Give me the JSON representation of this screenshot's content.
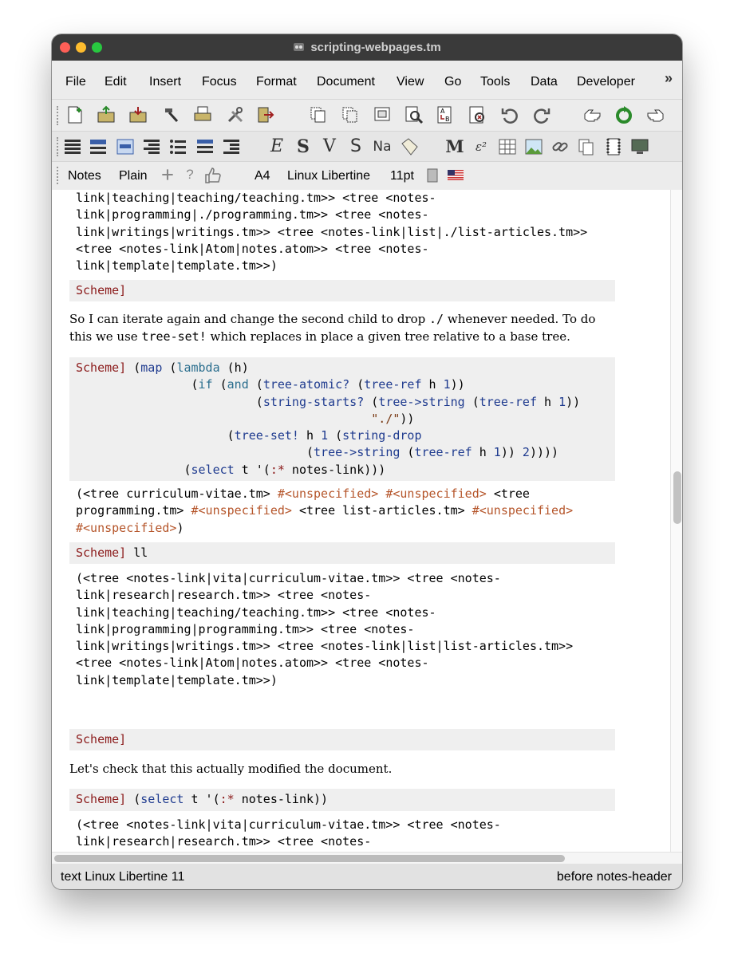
{
  "window": {
    "title": "scripting-webpages.tm"
  },
  "menu": {
    "items": [
      "File",
      "Edit",
      "Insert",
      "Focus",
      "Format",
      "Document",
      "View",
      "Go",
      "Tools",
      "Data",
      "Developer"
    ],
    "more": "»"
  },
  "format_bar": {
    "style": "Notes",
    "paragraph": "Plain",
    "paper": "A4",
    "font": "Linux Libertine",
    "size": "11pt"
  },
  "document": {
    "top_output": "link|teaching|teaching/teaching.tm>> <tree <notes-\nlink|programming|./programming.tm>> <tree <notes-\nlink|writings|writings.tm>> <tree <notes-link|list|./list-articles.tm>>\n<tree <notes-link|Atom|notes.atom>> <tree <notes-\nlink|template|template.tm>>)",
    "prompt": "Scheme]",
    "para1_a": "So I can iterate again and change the second child to drop ",
    "para1_code1": "./",
    "para1_b": " whenever needed. To do this we use ",
    "para1_code2": "tree-set!",
    "para1_c": " which replaces in place a given tree relative to a base tree.",
    "code": {
      "l1_map": "map",
      "l1_lambda": "lambda",
      "l1_h": " (h)",
      "l2_if": "if",
      "l2_and": "and",
      "l2_atomic": "tree-atomic?",
      "l2_ref": "tree-ref",
      "l2_h": " h ",
      "l2_one": "1",
      "l3_starts": "string-starts?",
      "l3_tostr": "tree->string",
      "l3_ref": "tree-ref",
      "l3_h": " h ",
      "l3_one": "1",
      "l4_str": "\"./\"",
      "l5_set": "tree-set!",
      "l5_h": " h ",
      "l5_one": "1",
      "l5_drop": "string-drop",
      "l6_tostr": "tree->string",
      "l6_ref": "tree-ref",
      "l6_h": " h ",
      "l6_one": "1",
      "l6_two": "2",
      "l7_select": "select",
      "l7_rest": " t '(",
      "l7_star": ":*",
      "l7_end": " notes-link)))"
    },
    "out2": {
      "a": "(<tree curriculum-vitae.tm> ",
      "u": "#<unspecified>",
      "b": "<tree",
      "c": "programming.tm> ",
      "d": " <tree list-articles.tm> ",
      "close": ")"
    },
    "cmd_ll": "ll",
    "out3": "(<tree <notes-link|vita|curriculum-vitae.tm>> <tree <notes-\nlink|research|research.tm>> <tree <notes-\nlink|teaching|teaching/teaching.tm>> <tree <notes-\nlink|programming|programming.tm>> <tree <notes-\nlink|writings|writings.tm>> <tree <notes-link|list|list-articles.tm>>\n<tree <notes-link|Atom|notes.atom>> <tree <notes-\nlink|template|template.tm>>)",
    "para2": "Let's check that this actually modified the document.",
    "cmd_select": "select",
    "cmd_select_rest": " t '(",
    "cmd_star": ":*",
    "cmd_end": " notes-link))",
    "out4": "(<tree <notes-link|vita|curriculum-vitae.tm>> <tree <notes-\nlink|research|research.tm>> <tree <notes-\nlink|teaching|teaching/teaching.tm>> <tree <notes-\nlink|programming|programming.tm>> <tree <notes-"
  },
  "status": {
    "left": "text Linux Libertine 11",
    "right": "before notes-header"
  },
  "colors": {
    "prompt": "#8b1a1a",
    "keyword": "#1f3b8f",
    "string": "#7a3b16",
    "unspecified": "#b5552a",
    "input_background": "#efefef"
  }
}
